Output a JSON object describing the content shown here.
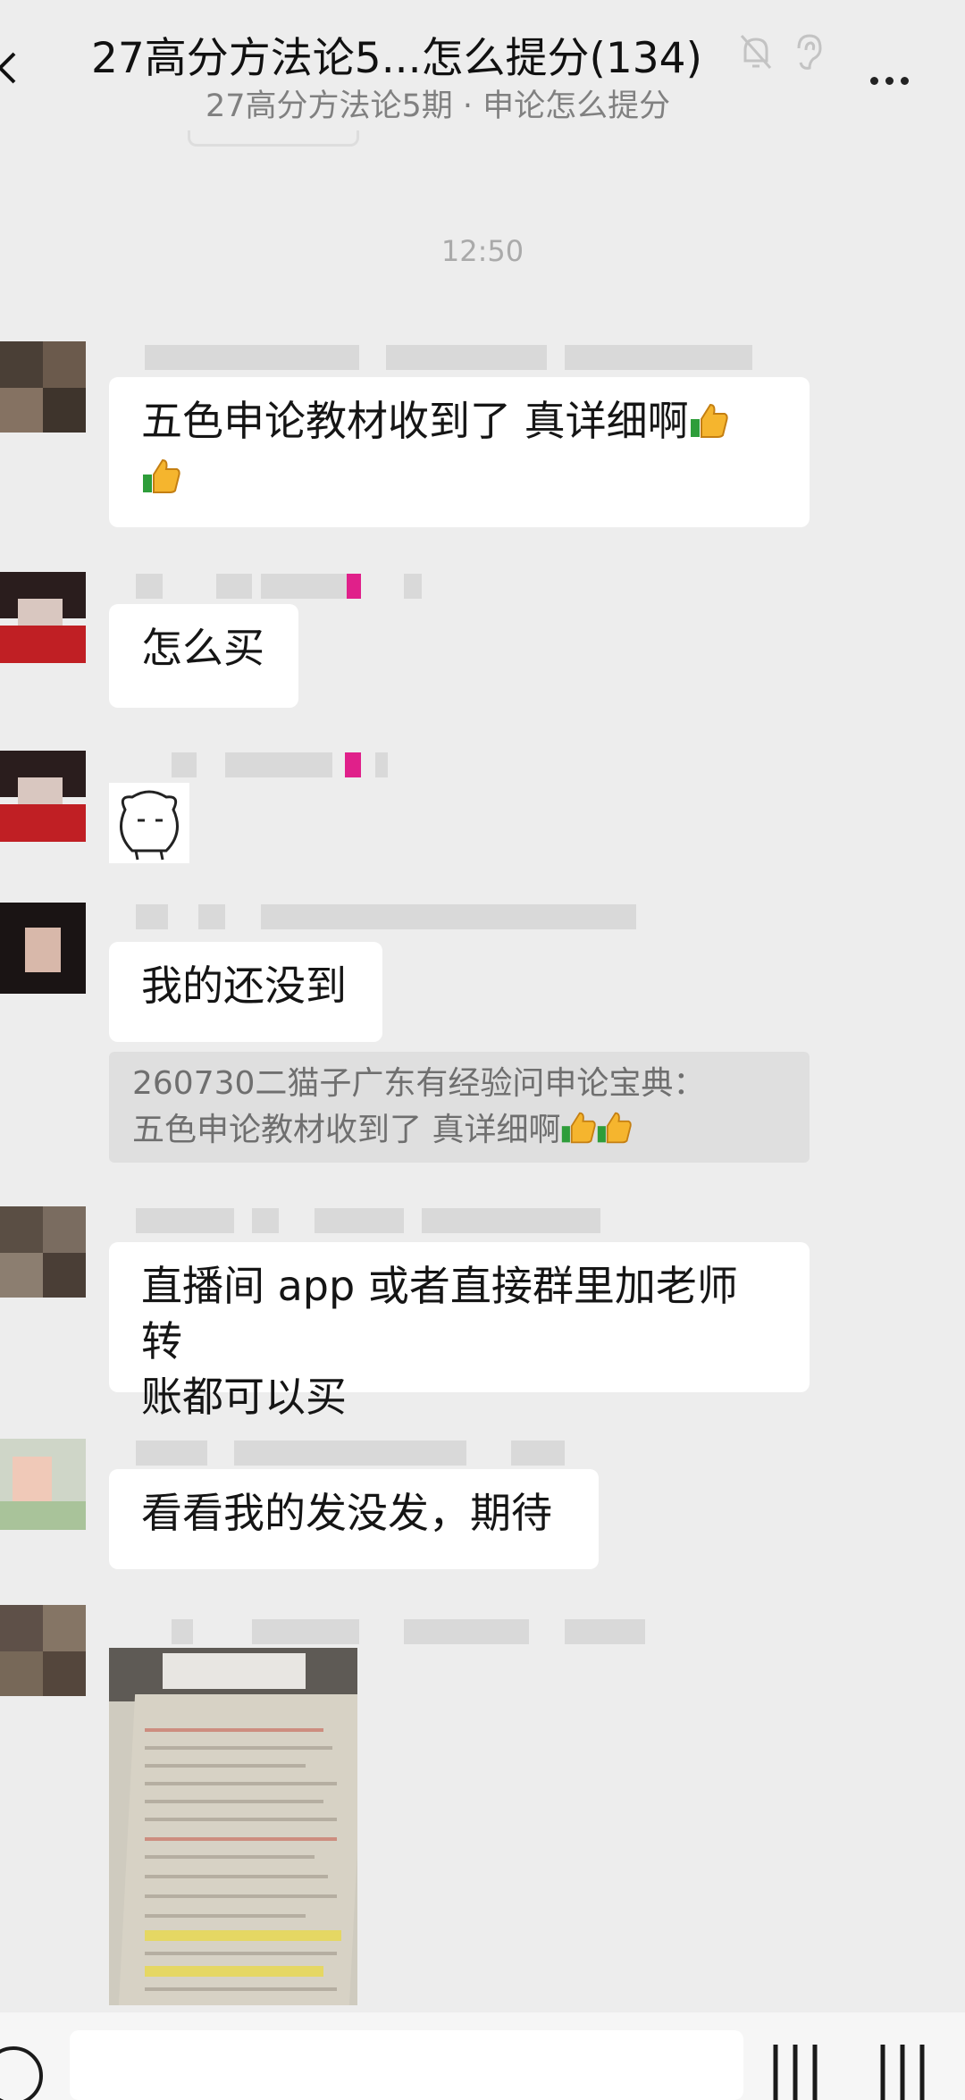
{
  "header": {
    "title": "27高分方法论5...怎么提分(134)",
    "subtitle": "27高分方法论5期 · 申论怎么提分",
    "icons": [
      "back-icon",
      "mute-bell-icon",
      "ear-icon",
      "more-icon"
    ]
  },
  "timestamp": "12:50",
  "messages": {
    "m1": {
      "line1": "五色申论教材收到了 真详细啊",
      "emoji": "thumbs-up"
    },
    "m2": {
      "text": "怎么买"
    },
    "m3": {
      "sticker": "sticker-icon"
    },
    "m4": {
      "text": "我的还没到",
      "quote_line1": "260730二猫子广东有经验问申论宝典：",
      "quote_line2": "五色申论教材收到了 真详细啊"
    },
    "m5": {
      "line1": "直播间 app 或者直接群里加老师转",
      "line2": "账都可以买"
    },
    "m6": {
      "text": "看看我的发没发，期待"
    },
    "m7": {
      "photo": "book-photo"
    }
  },
  "colors": {
    "background": "#ededed",
    "bubble": "#ffffff",
    "quote": "#dfdfdf",
    "timestamp": "#aaaaaa"
  }
}
